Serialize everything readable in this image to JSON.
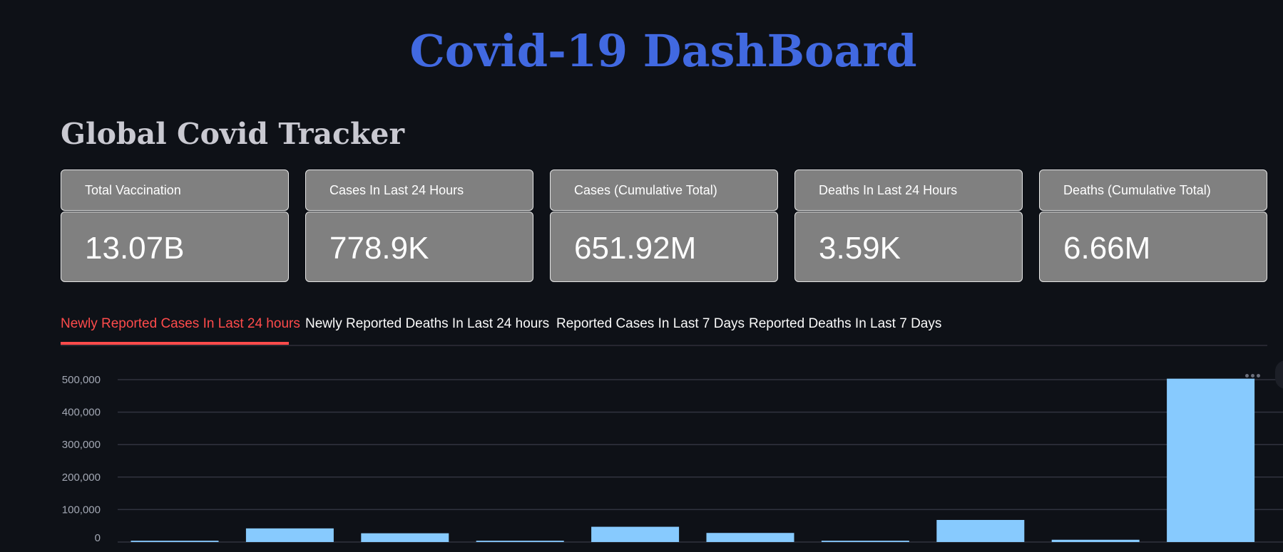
{
  "title": "Covid-19 DashBoard",
  "section_title": "Global Covid Tracker",
  "metrics": [
    {
      "label": "Total Vaccination",
      "value": "13.07B"
    },
    {
      "label": "Cases In Last 24 Hours",
      "value": "778.9K"
    },
    {
      "label": "Cases (Cumulative Total)",
      "value": "651.92M"
    },
    {
      "label": "Deaths In Last 24 Hours",
      "value": "3.59K"
    },
    {
      "label": "Deaths (Cumulative Total)",
      "value": "6.66M"
    }
  ],
  "tabs": [
    {
      "label": "Newly Reported Cases In Last 24 hours",
      "active": true
    },
    {
      "label": "Newly Reported Deaths In Last 24 hours",
      "active": false
    },
    {
      "label": "Reported Cases In Last 7 Days",
      "active": false
    },
    {
      "label": "Reported Deaths In Last 7 Days",
      "active": false
    }
  ],
  "colors": {
    "title": "#4169e1",
    "active_tab": "#ff4b4b",
    "bar": "#87cafe",
    "background": "#0e1117",
    "card": "#808080"
  },
  "chart_data": {
    "type": "bar",
    "values": [
      4000,
      42000,
      27000,
      4000,
      47000,
      28000,
      4000,
      68000,
      7000,
      503000
    ],
    "yticks": [
      0,
      100000,
      200000,
      300000,
      400000,
      500000
    ],
    "ytick_labels": [
      "0",
      "100,000",
      "200,000",
      "300,000",
      "400,000",
      "500,000"
    ],
    "ylim": [
      0,
      520000
    ],
    "grid": true
  },
  "chart_menu_icon": "more-horizontal-icon"
}
